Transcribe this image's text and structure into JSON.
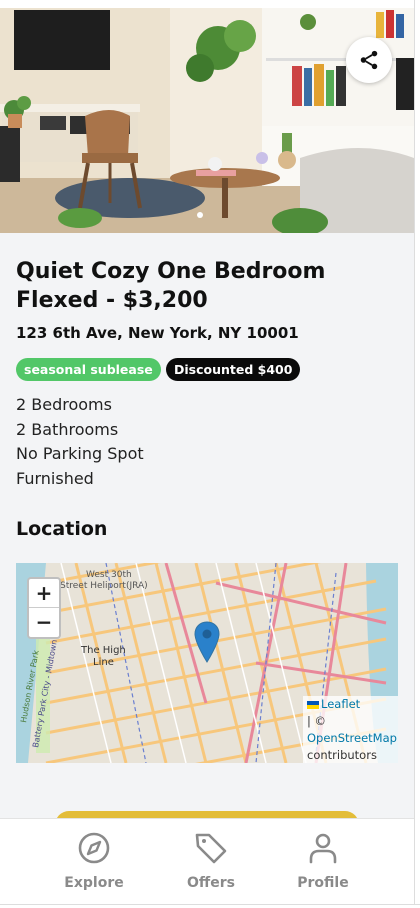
{
  "listing": {
    "title": "Quiet Cozy One Bedroom Flexed - $3,200",
    "address": "123 6th Ave, New York, NY 10001",
    "badges": [
      {
        "label": "seasonal sublease",
        "color": "#52c768"
      },
      {
        "label": "Discounted $400",
        "color": "#0a0a0a"
      }
    ],
    "features": [
      "2 Bedrooms",
      "2 Bathrooms",
      "No Parking Spot",
      "Furnished"
    ],
    "photo_index": 1
  },
  "location": {
    "heading": "Location",
    "zoom_in": "+",
    "zoom_out": "−",
    "map_labels": {
      "west30": "West 30th",
      "heliport": "Street Heliport(JRA)",
      "highline_1": "The High",
      "highline_2": "Line",
      "park": "Hudson River Park",
      "bikeway": "Battery Park City - Midtown"
    },
    "attribution": {
      "leaflet": "Leaflet",
      "sep": "| ©",
      "osm": "OpenStreetMap",
      "contributors": "contributors"
    }
  },
  "nav": {
    "items": [
      {
        "label": "Explore",
        "icon": "compass-icon"
      },
      {
        "label": "Offers",
        "icon": "tag-icon"
      },
      {
        "label": "Profile",
        "icon": "user-icon"
      }
    ]
  },
  "colors": {
    "accent_cta": "#e3bd3a",
    "badge_green": "#52c768",
    "nav_gray": "#8a8a8a",
    "map_pin": "#2a81cb"
  }
}
